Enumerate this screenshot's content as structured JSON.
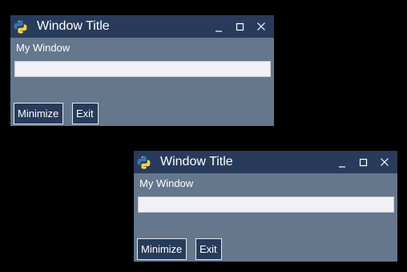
{
  "windows": [
    {
      "title": "Window Title",
      "label": "My Window",
      "input_value": "",
      "buttons": {
        "minimize": "Minimize",
        "exit": "Exit"
      },
      "controls": {
        "minimize_icon": "minimize-icon",
        "maximize_icon": "maximize-icon",
        "close_icon": "close-icon"
      }
    },
    {
      "title": "Window Title",
      "label": "My Window",
      "input_value": "",
      "buttons": {
        "minimize": "Minimize",
        "exit": "Exit"
      },
      "controls": {
        "minimize_icon": "minimize-icon",
        "maximize_icon": "maximize-icon",
        "close_icon": "close-icon"
      }
    }
  ],
  "colors": {
    "background": "#000000",
    "titlebar": "#283b5b",
    "window_body": "#64778d",
    "input_bg": "#f1f1f5",
    "button_bg": "#283b5b",
    "text": "#ffffff"
  }
}
